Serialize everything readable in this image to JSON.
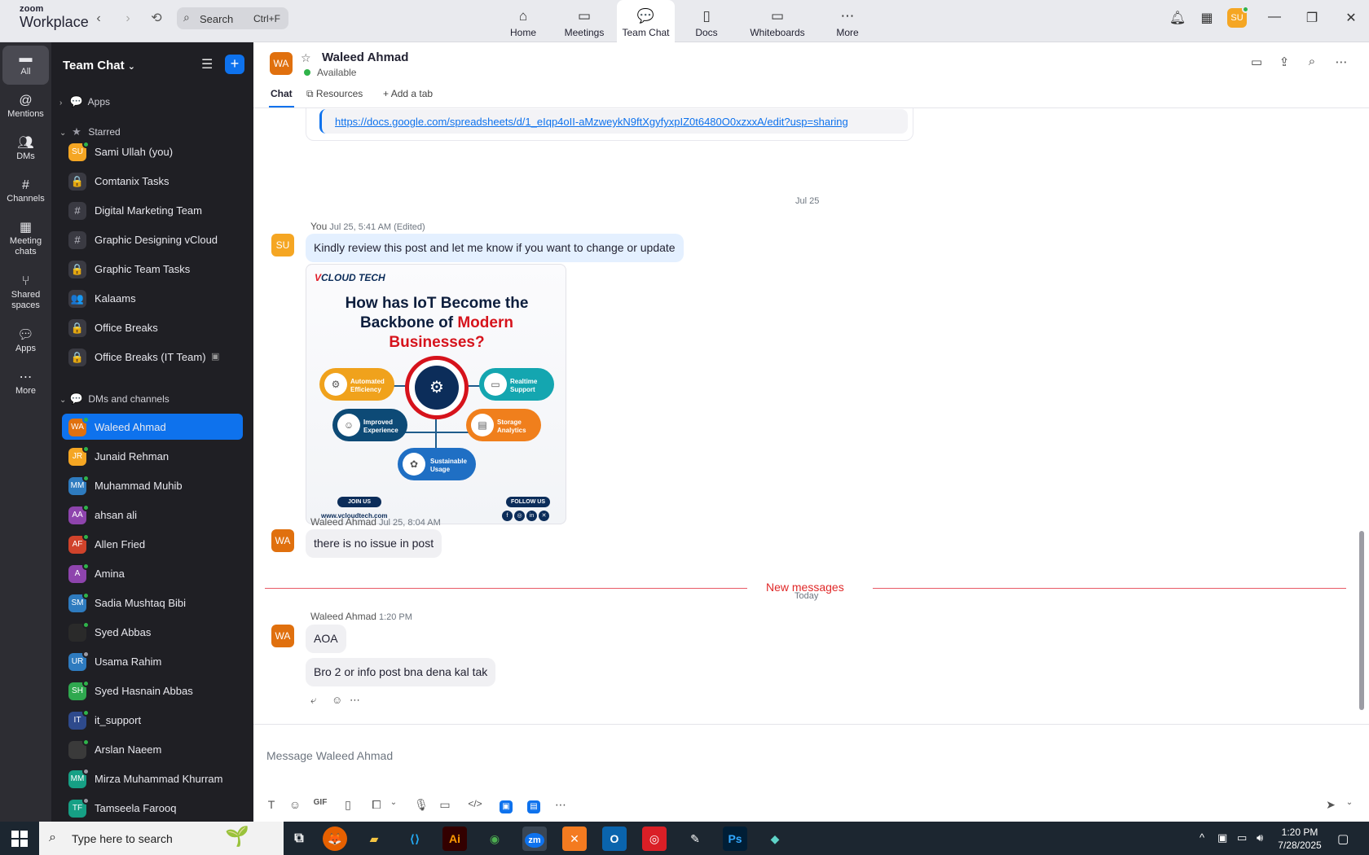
{
  "app": {
    "logo_line1": "zoom",
    "logo_line2": "Workplace"
  },
  "search": {
    "label": "Search",
    "shortcut": "Ctrl+F"
  },
  "top_tabs": [
    {
      "label": "Home",
      "icon": "home-icon"
    },
    {
      "label": "Meetings",
      "icon": "video-camera-icon"
    },
    {
      "label": "Team Chat",
      "icon": "chat-bubbles-icon"
    },
    {
      "label": "Docs",
      "icon": "document-icon"
    },
    {
      "label": "Whiteboards",
      "icon": "whiteboard-icon"
    },
    {
      "label": "More",
      "icon": "more-dots-icon"
    }
  ],
  "active_top_tab": "Team Chat",
  "me": {
    "initials": "SU",
    "avatar_color": "#f5a623"
  },
  "rail": [
    {
      "label": "All",
      "icon": "chat-icon"
    },
    {
      "label": "Mentions",
      "icon": "at-icon"
    },
    {
      "label": "DMs",
      "icon": "people-icon"
    },
    {
      "label": "Channels",
      "icon": "hash-icon"
    },
    {
      "label": "Meeting",
      "label2": "chats",
      "icon": "calendar-icon"
    },
    {
      "label": "Shared",
      "label2": "spaces",
      "icon": "share-icon"
    },
    {
      "label": "Apps",
      "icon": "apps-icon"
    },
    {
      "label": "More",
      "icon": "more-dots-icon"
    }
  ],
  "sidebar": {
    "title": "Team Chat",
    "sections": {
      "apps": "Apps",
      "starred": "Starred",
      "dms": "DMs and channels"
    },
    "starred": [
      {
        "name": "Sami Ullah (you)",
        "initials": "SU",
        "color": "#f5a623",
        "presence": "#2fb34a"
      },
      {
        "name": "Comtanix Tasks",
        "glyph": "🔒"
      },
      {
        "name": "Digital Marketing Team",
        "glyph": "#"
      },
      {
        "name": "Graphic Designing vCloud",
        "glyph": "#"
      },
      {
        "name": "Graphic Team Tasks",
        "glyph": "🔒"
      },
      {
        "name": "Kalaams",
        "glyph": "👥"
      },
      {
        "name": "Office Breaks",
        "glyph": "🔒"
      },
      {
        "name": "Office Breaks (IT Team)",
        "glyph": "🔒",
        "extra": "▣"
      }
    ],
    "dms": [
      {
        "name": "Waleed Ahmad",
        "initials": "WA",
        "color": "#e0700e",
        "presence": "#2fb34a",
        "active": true
      },
      {
        "name": "Junaid Rehman",
        "initials": "JR",
        "color": "#f5a623",
        "presence": "#2fb34a"
      },
      {
        "name": "Muhammad Muhib",
        "initials": "MM",
        "color": "#2e7bbf",
        "presence": "#2fb34a"
      },
      {
        "name": "ahsan ali",
        "initials": "AA",
        "color": "#8e44ad",
        "presence": "#2fb34a"
      },
      {
        "name": "Allen Fried",
        "initials": "AF",
        "color": "#d0432b",
        "presence": "#2fb34a"
      },
      {
        "name": "Amina",
        "initials": "A",
        "color": "#8e44ad",
        "presence": "#2fb34a"
      },
      {
        "name": "Sadia Mushtaq Bibi",
        "initials": "SM",
        "color": "#2e7bbf",
        "presence": "#2fb34a"
      },
      {
        "name": "Syed Abbas",
        "initials": "",
        "color": "#2a2a2a",
        "presence": "#2fb34a"
      },
      {
        "name": "Usama Rahim",
        "initials": "UR",
        "color": "#2e7bbf",
        "presence": "#9a9aa4"
      },
      {
        "name": "Syed Hasnain Abbas",
        "initials": "SH",
        "color": "#2fa84f",
        "presence": "#2fb34a"
      },
      {
        "name": "it_support",
        "initials": "IT",
        "color": "#2e4a8c",
        "presence": "#2fb34a"
      },
      {
        "name": "Arslan Naeem",
        "initials": "",
        "color": "#3a3a3a",
        "presence": "#2fb34a"
      },
      {
        "name": "Mirza Muhammad Khurram",
        "initials": "MM",
        "color": "#16a085",
        "presence": "#9a9aa4"
      },
      {
        "name": "Tamseela Farooq",
        "initials": "TF",
        "color": "#16a085",
        "presence": "#9a9aa4"
      }
    ]
  },
  "chat": {
    "contact": {
      "name": "Waleed Ahmad",
      "initials": "WA",
      "status": "Available"
    },
    "tabs": {
      "chat": "Chat",
      "resources": "Resources",
      "add_tab": "Add a tab"
    },
    "link": "https://docs.google.com/spreadsheets/d/1_eIqp4oII-aMzweykN9ftXgyfyxpIZ0t6480O0xzxxA/edit?usp=sharing",
    "day1": "Jul 25",
    "msg1": {
      "sender": "You",
      "time": "Jul 25, 5:41 AM (Edited)",
      "initials": "SU",
      "text": "Kindly review this post and let me know if you want to change or update"
    },
    "post": {
      "brand_v": "V",
      "brand": "CLOUD TECH",
      "heading_line1": "How has IoT Become the",
      "heading_line2a": "Backbone of ",
      "heading_line2b": "Modern",
      "heading_line3": "Businesses?",
      "pills": [
        "Automated Efficiency",
        "Realtime Support",
        "Improved Experience",
        "Storage Analytics",
        "Sustainable Usage"
      ],
      "join": "JOIN US",
      "follow": "FOLLOW US",
      "website": "www.vcloudtech.com"
    },
    "msg2": {
      "sender": "Waleed Ahmad",
      "time": "Jul 25, 8:04 AM",
      "initials": "WA",
      "text": "there is no issue in post"
    },
    "day2": "Today",
    "new_messages": "New messages",
    "msg3": {
      "sender": "Waleed Ahmad",
      "time": "1:20 PM",
      "initials": "WA",
      "text1": "AOA",
      "text2": "Bro 2 or info post bna dena kal tak"
    },
    "composer_placeholder": "Message Waleed Ahmad"
  },
  "taskbar": {
    "search": "Type here to search",
    "time": "1:20 PM",
    "date": "7/28/2025"
  }
}
